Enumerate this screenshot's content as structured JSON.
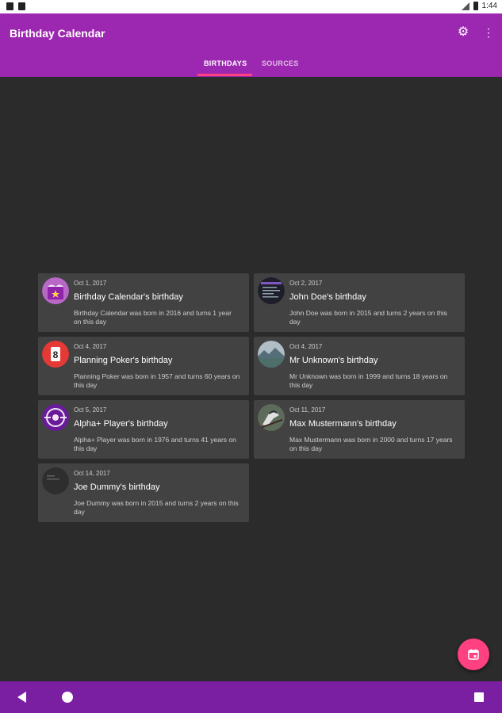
{
  "statusbar": {
    "time": "1:44"
  },
  "appbar": {
    "title": "Birthday Calendar"
  },
  "tabs": [
    {
      "label": "BIRTHDAYS",
      "active": true
    },
    {
      "label": "SOURCES",
      "active": false
    }
  ],
  "cards": [
    {
      "date": "Oct 1, 2017",
      "title": "Birthday Calendar's birthday",
      "desc": "Birthday Calendar was born in 2016 and turns 1 year on this day",
      "icon": "birthday-cake-icon"
    },
    {
      "date": "Oct 2, 2017",
      "title": "John Doe's birthday",
      "desc": "John Doe was born in 2015 and turns 2 years on this day",
      "icon": "screenshot-avatar"
    },
    {
      "date": "Oct 4, 2017",
      "title": "Planning Poker's birthday",
      "desc": "Planning Poker was born in 1957 and turns 60 years on this day",
      "icon": "poker-card-icon"
    },
    {
      "date": "Oct 4, 2017",
      "title": "Mr Unknown's birthday",
      "desc": "Mr Unknown was born in 1999 and turns 18 years on this day",
      "icon": "landscape-avatar"
    },
    {
      "date": "Oct 5, 2017",
      "title": "Alpha+ Player's birthday",
      "desc": "Alpha+ Player was born in 1976 and turns 41 years on this day",
      "icon": "player-icon"
    },
    {
      "date": "Oct 11, 2017",
      "title": "Max Mustermann's birthday",
      "desc": "Max Mustermann was born in 2000 and turns 17 years on this day",
      "icon": "bird-avatar"
    },
    {
      "date": "Oct 14, 2017",
      "title": "Joe Dummy's birthday",
      "desc": "Joe Dummy was born in 2015 and turns 2 years on this day",
      "icon": "dark-avatar"
    }
  ],
  "colors": {
    "primary": "#9c27b0",
    "primary_dark": "#7b1fa2",
    "accent": "#ff4081",
    "card": "#424242",
    "background": "#2b2b2b"
  }
}
